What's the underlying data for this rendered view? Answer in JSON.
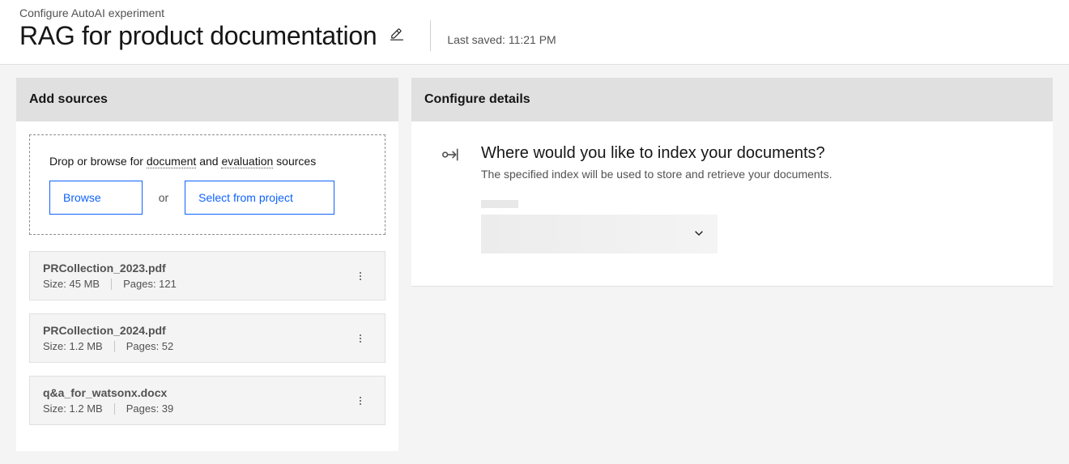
{
  "header": {
    "breadcrumb": "Configure AutoAI experiment",
    "title": "RAG for product documentation",
    "last_saved": "Last saved: 11:21 PM"
  },
  "sources": {
    "panel_title": "Add sources",
    "drop_pre": "Drop or browse for ",
    "drop_link1": "document",
    "drop_mid": " and ",
    "drop_link2": "evaluation",
    "drop_post": " sources",
    "browse_label": "Browse",
    "or_label": "or",
    "select_label": "Select from project",
    "files": [
      {
        "name": "PRCollection_2023.pdf",
        "size": "Size: 45 MB",
        "pages": "Pages: 121"
      },
      {
        "name": "PRCollection_2024.pdf",
        "size": "Size: 1.2 MB",
        "pages": "Pages: 52"
      },
      {
        "name": "q&a_for_watsonx.docx",
        "size": "Size: 1.2 MB",
        "pages": "Pages: 39"
      }
    ]
  },
  "configure": {
    "panel_title": "Configure details",
    "question": "Where would you like to index your documents?",
    "description": "The specified index will be used to store and retrieve your documents."
  }
}
